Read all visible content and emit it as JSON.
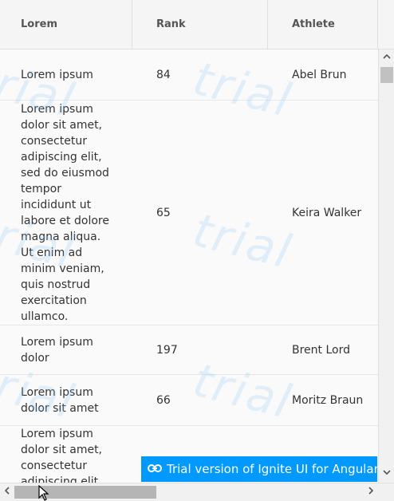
{
  "columns": {
    "col1": "Lorem",
    "col2": "Rank",
    "col3": "Athlete"
  },
  "rows": [
    {
      "lorem": "Lorem ipsum",
      "rank": "84",
      "athlete": "Abel Brun"
    },
    {
      "lorem": "Lorem ipsum dolor sit amet, consectetur adipiscing elit, sed do eiusmod tempor incididunt ut labore et dolore magna aliqua. Ut enim ad minim veniam, quis nostrud exercitation ullamco.",
      "rank": "65",
      "athlete": "Keira Walker"
    },
    {
      "lorem": "Lorem ipsum dolor",
      "rank": "197",
      "athlete": "Brent Lord"
    },
    {
      "lorem": "Lorem ipsum dolor sit amet",
      "rank": "66",
      "athlete": "Moritz Braun"
    },
    {
      "lorem": "Lorem ipsum dolor sit amet, consectetur adipiscing elit",
      "rank": "",
      "athlete": ""
    }
  ],
  "watermark": "trial",
  "banner": {
    "text": "Trial version of Ignite UI for Angular",
    "color": "#0099ff",
    "icon": "link-icon"
  },
  "scrollbars": {
    "up_arrow": "^",
    "down_arrow": "v",
    "left_arrow": "<",
    "right_arrow": ">"
  }
}
